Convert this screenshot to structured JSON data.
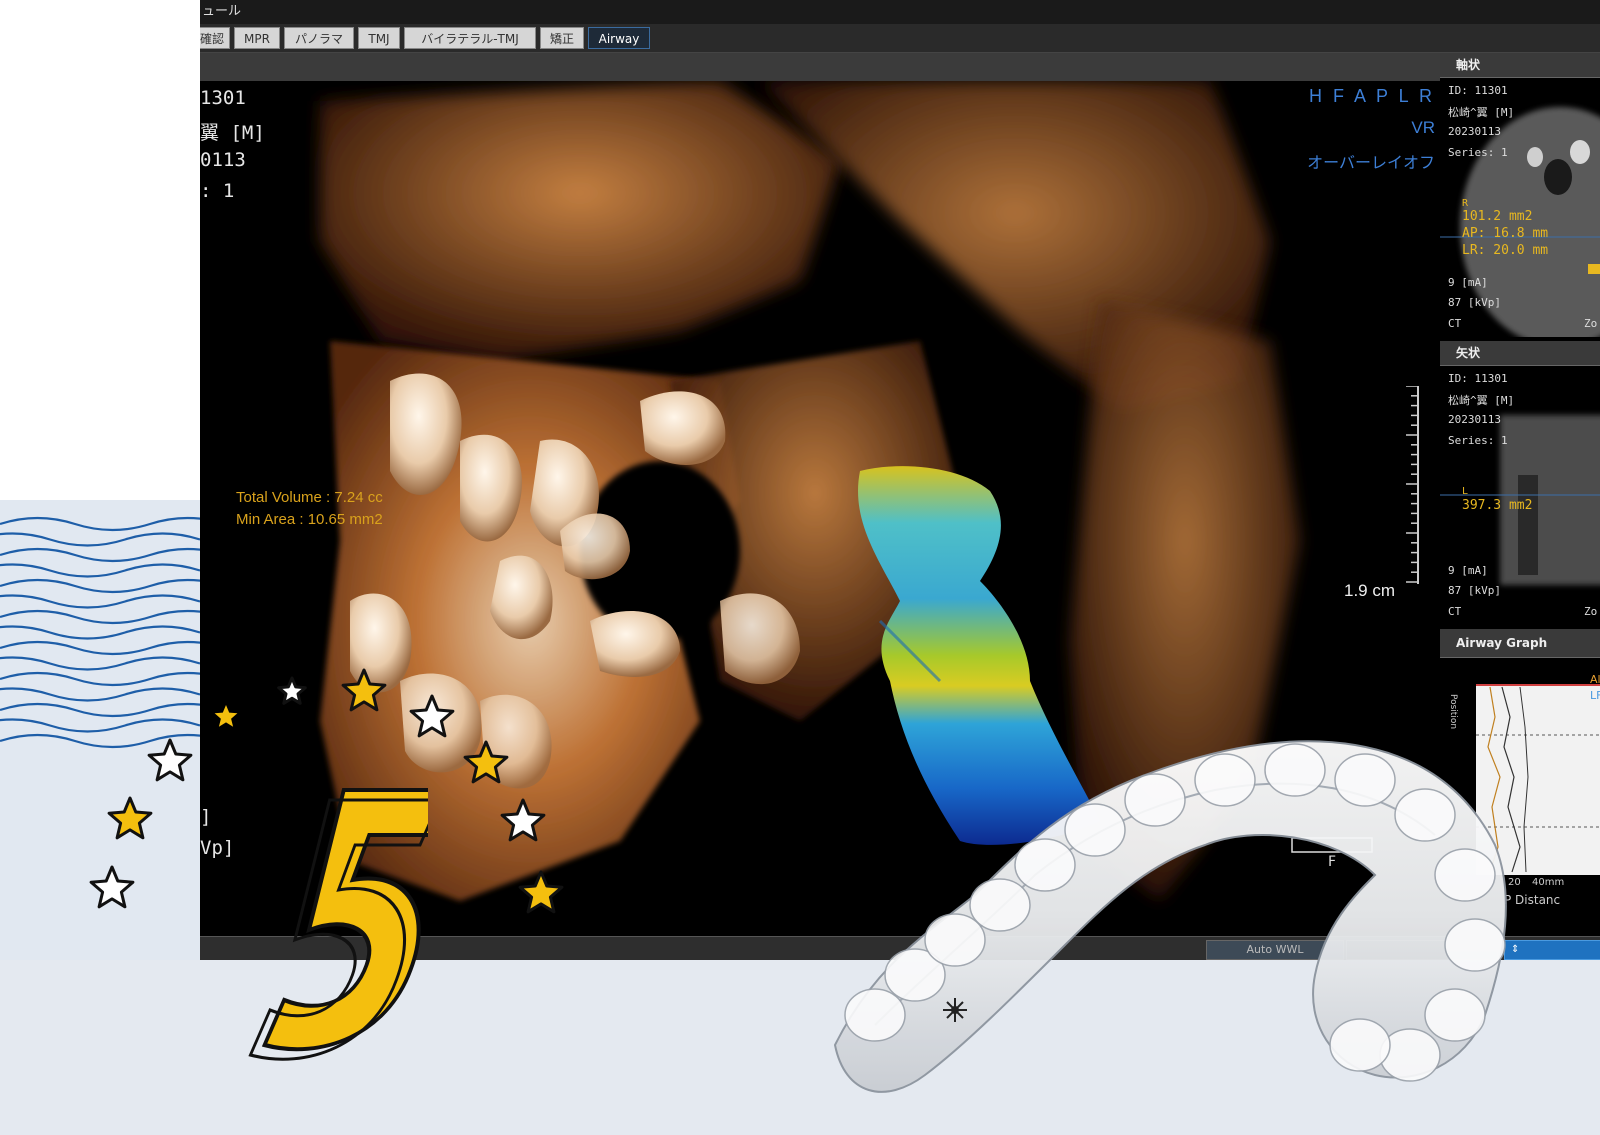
{
  "app": {
    "title": "ュール",
    "tabs": [
      {
        "label": "確認",
        "active": false
      },
      {
        "label": "MPR",
        "active": false
      },
      {
        "label": "パノラマ",
        "active": false
      },
      {
        "label": "TMJ",
        "active": false
      },
      {
        "label": "バイラテラル-TMJ",
        "active": false
      },
      {
        "label": "矯正",
        "active": false
      },
      {
        "label": "Airway",
        "active": true
      }
    ]
  },
  "main_view": {
    "patient_info": [
      "1301",
      "翼 [M]",
      "0113",
      ": 1"
    ],
    "bottom_info": [
      "]",
      "Vp]"
    ],
    "orientation": "H F A P L R",
    "render_mode": "VR",
    "overlay_state": "オーバーレイオフ",
    "total_volume": "Total Volume : 7.24 cc",
    "min_area": "Min Area : 10.65 mm2",
    "scale_label": "1.9 cm"
  },
  "axial_panel": {
    "title": "軸状",
    "info": [
      "ID: 11301",
      "松崎^翼 [M]",
      "20230113",
      "Series: 1"
    ],
    "marker": "R",
    "area": "101.2 mm2",
    "ap": "AP: 16.8 mm",
    "lr": "LR: 20.0 mm",
    "params": [
      "9 [mA]",
      "87 [kVp]",
      "CT"
    ],
    "zoom": "Zo"
  },
  "sagittal_panel": {
    "title": "矢状",
    "info": [
      "ID: 11301",
      "松崎^翼 [M]",
      "20230113",
      "Series: 1"
    ],
    "marker": "L",
    "area": "397.3 mm2",
    "params": [
      "9 [mA]",
      "87 [kVp]",
      "CT"
    ],
    "zoom": "Zo"
  },
  "airway_graph": {
    "title": "Airway Graph",
    "y_label": "Position",
    "legend": [
      "Al",
      "LF"
    ],
    "x_ticks": [
      "20",
      "40mm"
    ],
    "x_label": "P Distanc"
  },
  "status": {
    "auto_wwl": "Auto WWL",
    "dropdown_glyph": "⇕"
  },
  "decor": {
    "number": "5",
    "scale_marker": "F"
  },
  "colors": {
    "accent_blue": "#3d7fd6",
    "measure_yellow": "#d9a21c",
    "number_yellow": "#f4bf0e",
    "bone": "#b8652a",
    "wave_blue": "#1e5ea8"
  }
}
